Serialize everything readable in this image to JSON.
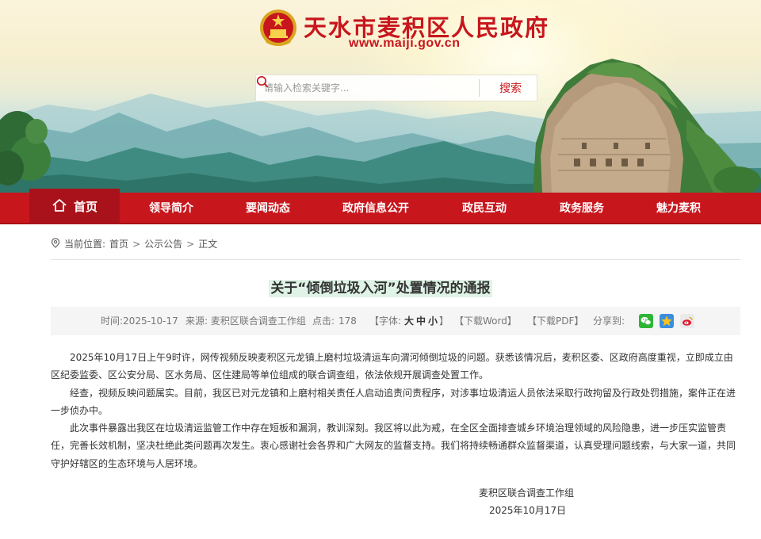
{
  "header": {
    "site_title": "天水市麦积区人民政府",
    "site_url": "www.maiji.gov.cn",
    "search": {
      "placeholder": "请输入检索关键字...",
      "button_label": "搜索"
    }
  },
  "nav": {
    "items": [
      {
        "label": "首页",
        "active": true
      },
      {
        "label": "领导简介"
      },
      {
        "label": "要闻动态"
      },
      {
        "label": "政府信息公开"
      },
      {
        "label": "政民互动"
      },
      {
        "label": "政务服务"
      },
      {
        "label": "魅力麦积"
      }
    ]
  },
  "breadcrumb": {
    "prefix": "当前位置:",
    "items": [
      "首页",
      "公示公告",
      "正文"
    ],
    "separator": ">"
  },
  "article": {
    "title": "关于“倾倒垃圾入河”处置情况的通报",
    "meta": {
      "time_label": "时间:2025-10-17",
      "source_label": "来源: 麦积区联合调查工作组",
      "clicks_label": "点击:",
      "clicks": "178",
      "font_label": "【字体:",
      "font_large": "大",
      "font_medium": "中",
      "font_small": "小",
      "font_end": "】",
      "download_word": "【下载Word】",
      "download_pdf": "【下载PDF】",
      "share_label": "分享到:"
    },
    "paragraphs": [
      "2025年10月17日上午9时许，网传视频反映麦积区元龙镇上磨村垃圾清运车向渭河倾倒垃圾的问题。获悉该情况后，麦积区委、区政府高度重视，立即成立由区纪委监委、区公安分局、区水务局、区住建局等单位组成的联合调查组，依法依规开展调查处置工作。",
      "经查，视频反映问题属实。目前，我区已对元龙镇和上磨村相关责任人启动追责问责程序，对涉事垃圾清运人员依法采取行政拘留及行政处罚措施，案件正在进一步侦办中。",
      "此次事件暴露出我区在垃圾清运监管工作中存在短板和漏洞，教训深刻。我区将以此为戒，在全区全面排查城乡环境治理领域的风险隐患，进一步压实监管责任，完善长效机制，坚决杜绝此类问题再次发生。衷心感谢社会各界和广大网友的监督支持。我们将持续畅通群众监督渠道，认真受理问题线索，与大家一道，共同守护好辖区的生态环境与人居环境。"
    ],
    "signature": "麦积区联合调查工作组",
    "date": "2025年10月17日"
  },
  "colors": {
    "brand_red": "#c8161d",
    "nav_active": "#a9121a",
    "title_highlight": "#dff3e6",
    "meta_bg": "#f5f5f5"
  },
  "icons": [
    "national-emblem-icon",
    "search-icon",
    "home-icon",
    "location-icon",
    "wechat-icon",
    "qzone-icon",
    "weibo-icon"
  ]
}
